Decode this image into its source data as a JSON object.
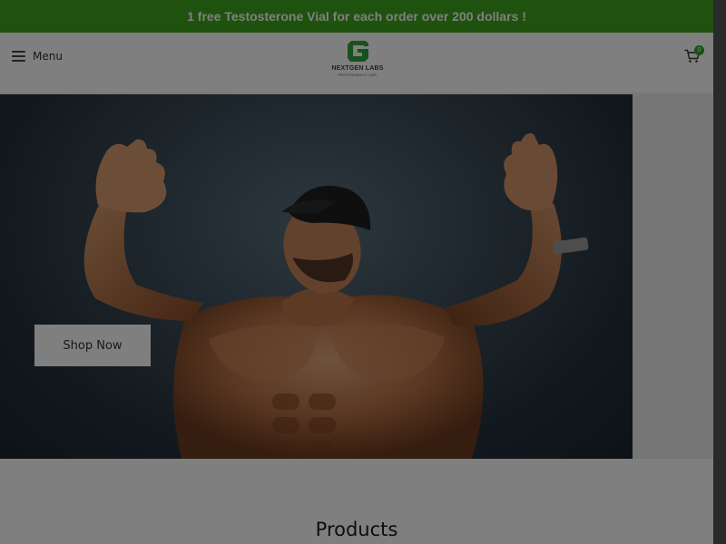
{
  "announcement": {
    "text": "1 free Testosterone Vial for each order over 200 dollars !"
  },
  "header": {
    "menu_label": "Menu",
    "logo": {
      "name": "NEXTGEN LABS",
      "tagline": "PERFORMANCE LABS"
    },
    "cart_count": "0"
  },
  "hero": {
    "cta_label": "Shop Now"
  },
  "products": {
    "title": "Products"
  },
  "colors": {
    "brand_green": "#3fa51c",
    "overlay": "rgba(0,0,0,0.5)"
  },
  "icons": [
    "hamburger-icon",
    "logo-icon",
    "cart-icon"
  ]
}
